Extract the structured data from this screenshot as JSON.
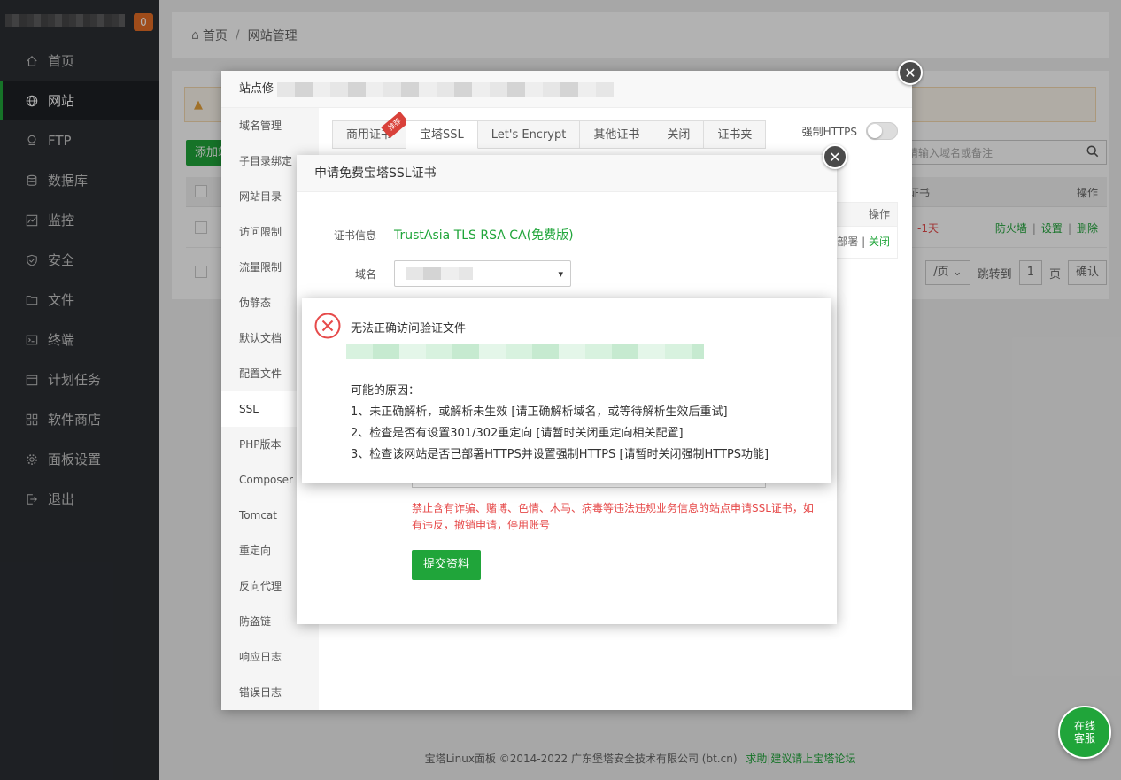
{
  "sidebar": {
    "badge": "0",
    "items": [
      {
        "label": "首页",
        "icon": "home-icon"
      },
      {
        "label": "网站",
        "icon": "globe-icon"
      },
      {
        "label": "FTP",
        "icon": "ftp-icon"
      },
      {
        "label": "数据库",
        "icon": "database-icon"
      },
      {
        "label": "监控",
        "icon": "monitor-icon"
      },
      {
        "label": "安全",
        "icon": "shield-icon"
      },
      {
        "label": "文件",
        "icon": "folder-icon"
      },
      {
        "label": "终端",
        "icon": "terminal-icon"
      },
      {
        "label": "计划任务",
        "icon": "calendar-icon"
      },
      {
        "label": "软件商店",
        "icon": "apps-icon"
      },
      {
        "label": "面板设置",
        "icon": "gear-icon"
      },
      {
        "label": "退出",
        "icon": "logout-icon"
      }
    ],
    "active_index": 1
  },
  "breadcrumb": {
    "home": "首页",
    "sep": "/",
    "current": "网站管理"
  },
  "page": {
    "add_button": "添加站",
    "search_placeholder": "请输入域名或备注",
    "col_cert": "证书",
    "col_ops": "操作",
    "row_days": "-1天",
    "row_op_firewall": "防火墙",
    "row_op_settings": "设置",
    "row_op_delete": "删除",
    "pager_per_page": "/页",
    "pager_jump": "跳转到",
    "pager_page_value": "1",
    "pager_page_unit": "页",
    "pager_confirm": "确认"
  },
  "footer": {
    "copyright": "宝塔Linux面板 ©2014-2022 广东堡塔安全技术有限公司 (bt.cn)",
    "link": "求助|建议请上宝塔论坛"
  },
  "site_modal": {
    "title_prefix": "站点修",
    "side_items": [
      "域名管理",
      "子目录绑定",
      "网站目录",
      "访问限制",
      "流量限制",
      "伪静态",
      "默认文档",
      "配置文件",
      "SSL",
      "PHP版本",
      "Composer",
      "Tomcat",
      "重定向",
      "反向代理",
      "防盗链",
      "响应日志",
      "错误日志"
    ],
    "side_active": 8,
    "tabs": [
      "商用证书",
      "宝塔SSL",
      "Let's Encrypt",
      "其他证书",
      "关闭",
      "证书夹"
    ],
    "tab_active": 1,
    "ribbon": "推荐",
    "force_https": "强制HTTPS",
    "force_https_on": false,
    "inner_head": "操作",
    "inner_row_text": "部署",
    "inner_row_link": "关闭"
  },
  "ssl_modal": {
    "title": "申请免费宝塔SSL证书",
    "cert_label": "证书信息",
    "cert_value": "TrustAsia TLS RSA CA(免费版)",
    "domain_label": "域名",
    "warning": "禁止含有诈骗、赌博、色情、木马、病毒等违法违规业务信息的站点申请SSL证书，如有违反，撤销申请，停用账号",
    "submit": "提交资料"
  },
  "error_dialog": {
    "title": "无法正确访问验证文件",
    "reasons_title": "可能的原因：",
    "reasons": [
      "1、未正确解析，或解析未生效 [请正确解析域名，或等待解析生效后重试]",
      "2、检查是否有设置301/302重定向 [请暂时关闭重定向相关配置]",
      "3、检查该网站是否已部署HTTPS并设置强制HTTPS [请暂时关闭强制HTTPS功能]"
    ]
  },
  "online_service": {
    "line1": "在线",
    "line2": "客服"
  },
  "colors": {
    "accent": "#20a53a",
    "danger": "#e64a4a",
    "sidebar_bg": "#2b2e33"
  }
}
